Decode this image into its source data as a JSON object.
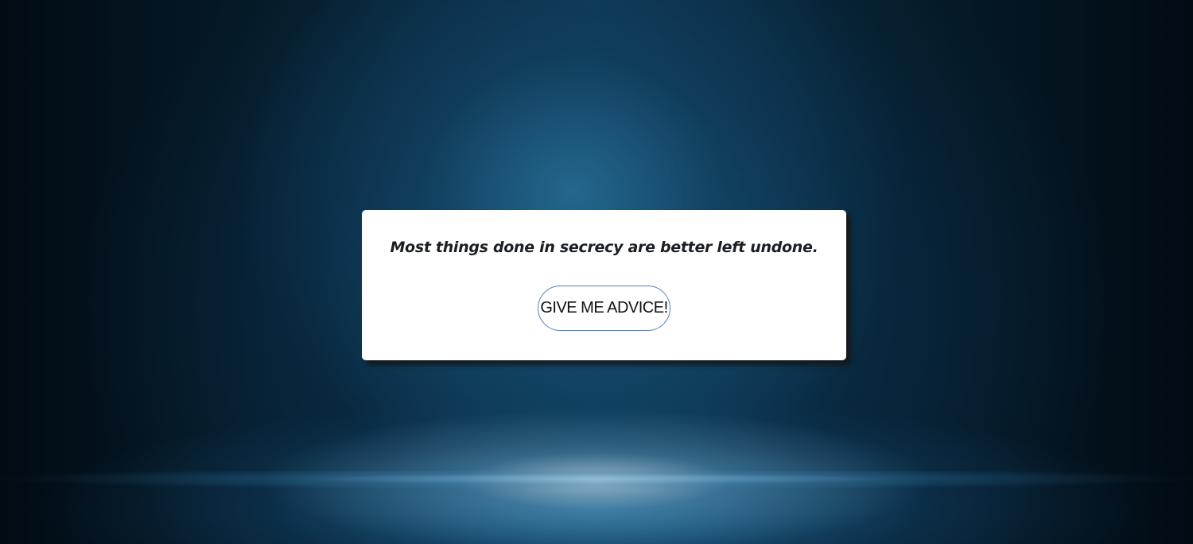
{
  "advice": {
    "text": "Most things done in secrecy are better left undone."
  },
  "button": {
    "label": "GIVE ME ADVICE!"
  },
  "colors": {
    "card_background": "#ffffff",
    "button_border": "#5a7fb5",
    "page_background": "#041521"
  }
}
